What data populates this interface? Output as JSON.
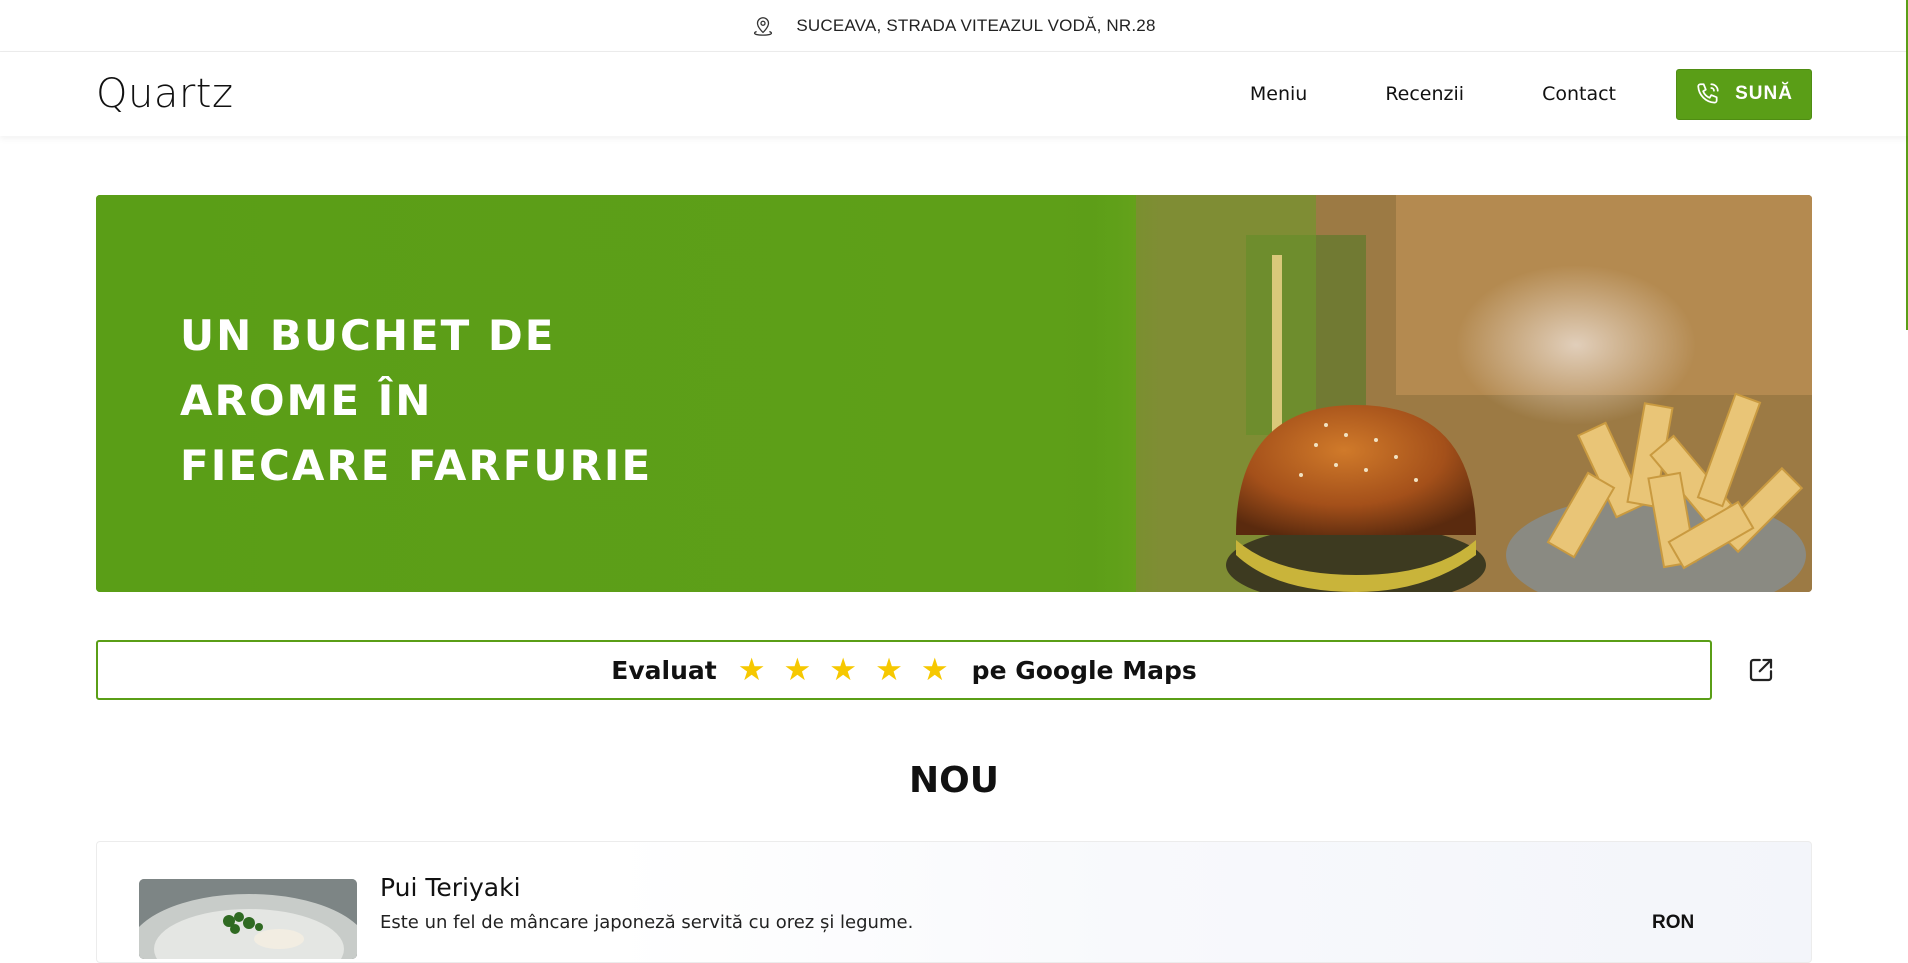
{
  "topbar": {
    "address": "SUCEAVA, STRADA VITEAZUL VODĂ, NR.28",
    "icon": "location-pin-icon"
  },
  "header": {
    "logo": "Quartz",
    "nav": [
      {
        "label": "Meniu"
      },
      {
        "label": "Recenzii"
      },
      {
        "label": "Contact"
      }
    ],
    "call_button": {
      "label": "SUNĂ",
      "icon": "phone-icon"
    }
  },
  "hero": {
    "title_lines": [
      "UN BUCHET DE",
      "AROME ÎN",
      "FIECARE FARFURIE"
    ]
  },
  "rating": {
    "prefix": "Evaluat",
    "stars": 5,
    "suffix": "pe Google Maps",
    "star_color": "#f6c800",
    "link_icon": "external-link-icon"
  },
  "section": {
    "title": "NOU"
  },
  "menu_items": [
    {
      "name": "Pui Teriyaki",
      "description": "Este un fel de mâncare japoneză servită cu orez și legume.",
      "currency": "RON"
    }
  ],
  "colors": {
    "accent": "#5a9e17",
    "text": "#111111"
  }
}
